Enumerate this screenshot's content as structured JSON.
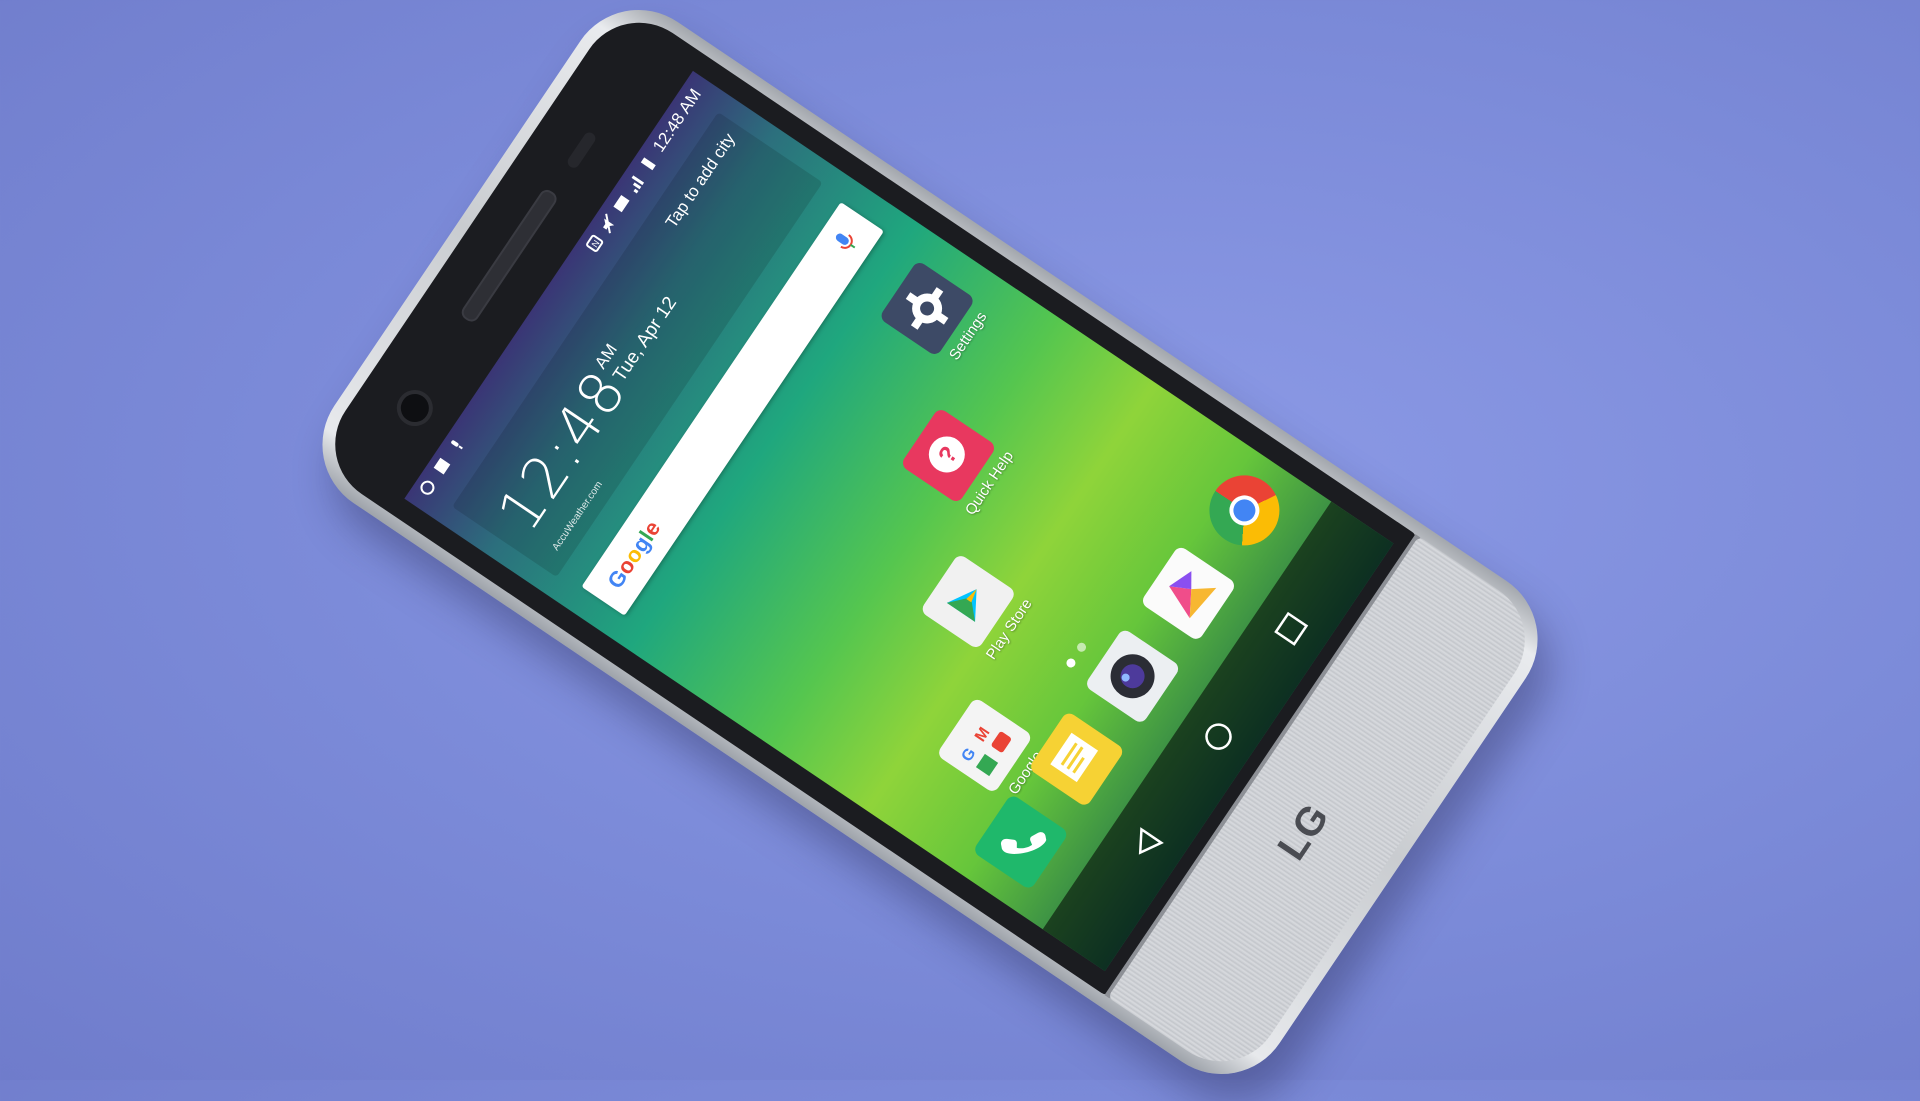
{
  "status_bar": {
    "time": "12:48 AM"
  },
  "weather_widget": {
    "clock_time": "12:48",
    "am_pm": "AM",
    "date": "Tue, Apr 12",
    "city_prompt": "Tap to add city",
    "provider": "AccuWeather.com"
  },
  "search_bar": {
    "logo_text": "Google"
  },
  "home_apps": [
    {
      "label": "Settings"
    },
    {
      "label": "Quick Help"
    },
    {
      "label": "Play Store"
    },
    {
      "label": "Google"
    }
  ],
  "dock_apps": [
    {
      "icon": "phone-icon"
    },
    {
      "icon": "messaging-icon"
    },
    {
      "icon": "camera-icon"
    },
    {
      "icon": "gallery-icon"
    },
    {
      "icon": "chrome-icon"
    }
  ],
  "brand": {
    "logo_text": "LG"
  },
  "colors": {
    "background": "#7b8ad8",
    "settings_tile": "#3d4a66",
    "quick_help_tile": "#e8385f",
    "phone_tile": "#1fb86b",
    "messaging_tile": "#f6d234"
  }
}
